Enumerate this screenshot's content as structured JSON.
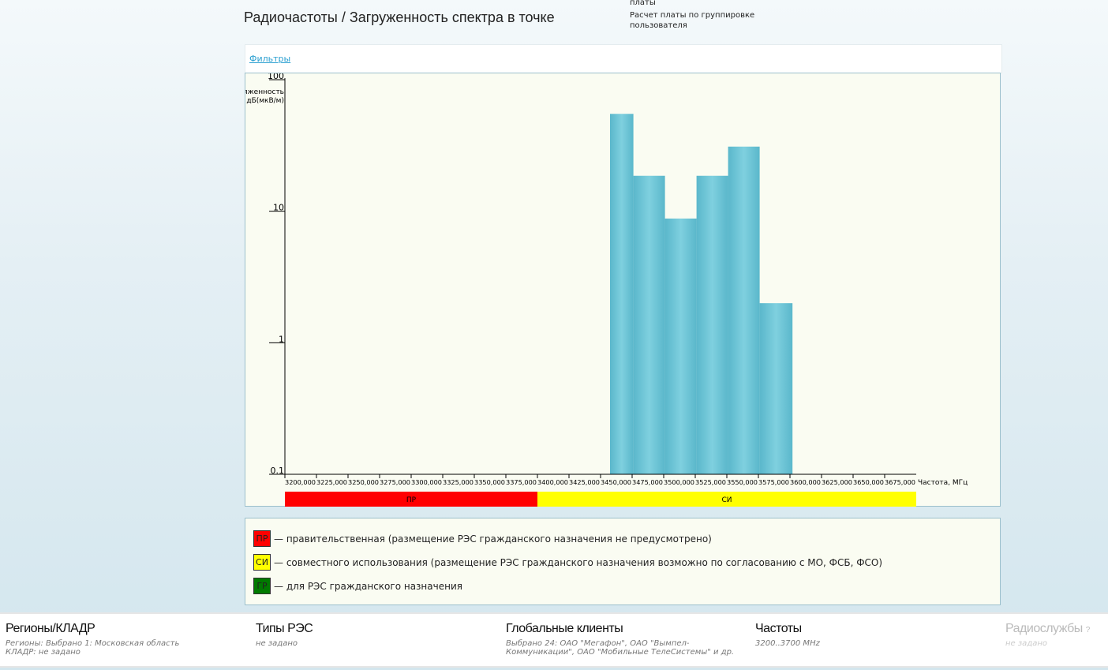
{
  "header": {
    "title": "Радиочастоты / Загруженность спектра в точке",
    "links": [
      "платы",
      "Расчет платы по группировке пользователя"
    ]
  },
  "filters_label": "Фильтры",
  "chart_data": {
    "type": "bar",
    "y_scale": "log",
    "ylim": [
      0.1,
      100
    ],
    "ylabel_lines": [
      "яженность",
      "дБ(мкВ/м)"
    ],
    "yticks": [
      "100",
      "10",
      "1",
      "0.1"
    ],
    "ytick_values": [
      100,
      10,
      1,
      0.1
    ],
    "xlabel": "Частота, МГц",
    "xlim": [
      3200,
      3700
    ],
    "xticks": [
      3200,
      3225,
      3250,
      3275,
      3300,
      3325,
      3350,
      3375,
      3400,
      3425,
      3450,
      3475,
      3500,
      3525,
      3550,
      3575,
      3600,
      3625,
      3650,
      3675
    ],
    "xtick_labels": [
      "3200,000",
      "3225,000",
      "3250,000",
      "3275,000",
      "3300,000",
      "3325,000",
      "3350,000",
      "3375,000",
      "3400,000",
      "3425,000",
      "3450,000",
      "3475,000",
      "3500,000",
      "3525,000",
      "3550,000",
      "3575,000",
      "3600,000",
      "3625,000",
      "3650,000",
      "3675,000"
    ],
    "bars": [
      {
        "from": 3457.5,
        "to": 3476,
        "value": 55
      },
      {
        "from": 3476,
        "to": 3501,
        "value": 18.6
      },
      {
        "from": 3501,
        "to": 3526,
        "value": 8.8
      },
      {
        "from": 3526,
        "to": 3551,
        "value": 18.6
      },
      {
        "from": 3551,
        "to": 3576,
        "value": 31
      },
      {
        "from": 3576,
        "to": 3602,
        "value": 2
      }
    ],
    "bar_color": "#6cc3d5",
    "bands": [
      {
        "label": "ПР",
        "from": 3200,
        "to": 3400,
        "color": "#ff0000"
      },
      {
        "label": "СИ",
        "from": 3400,
        "to": 3700,
        "color": "#ffff00"
      }
    ]
  },
  "legend": [
    {
      "code": "ПР",
      "color": "#ff0000",
      "text": "— правительственная (размещение РЭС гражданского назначения не предусмотрено)"
    },
    {
      "code": "СИ",
      "color": "#ffff00",
      "text": "— совместного использования (размещение РЭС гражданского назначения возможно по согласованию с МО, ФСБ, ФСО)"
    },
    {
      "code": "ГР",
      "color": "#007a00",
      "text": "— для РЭС гражданского назначения"
    }
  ],
  "footer": [
    {
      "title": "Регионы/КЛАДР",
      "lines": [
        "Регионы: Выбрано 1: Московская область",
        "КЛАДР: не задано"
      ]
    },
    {
      "title": "Типы РЭС",
      "lines": [
        "не задано"
      ]
    },
    {
      "title": "Глобальные клиенты",
      "lines": [
        "Выбрано 24: ОАО \"Мегафон\", ОАО \"Вымпел-",
        "Коммуникации\", ОАО \"Мобильные ТелеСистемы\" и др."
      ]
    },
    {
      "title": "Частоты",
      "lines": [
        "3200..3700 MHz"
      ]
    },
    {
      "title": "Радиослужбы",
      "lines": [
        "не задано"
      ],
      "help": "?"
    }
  ]
}
